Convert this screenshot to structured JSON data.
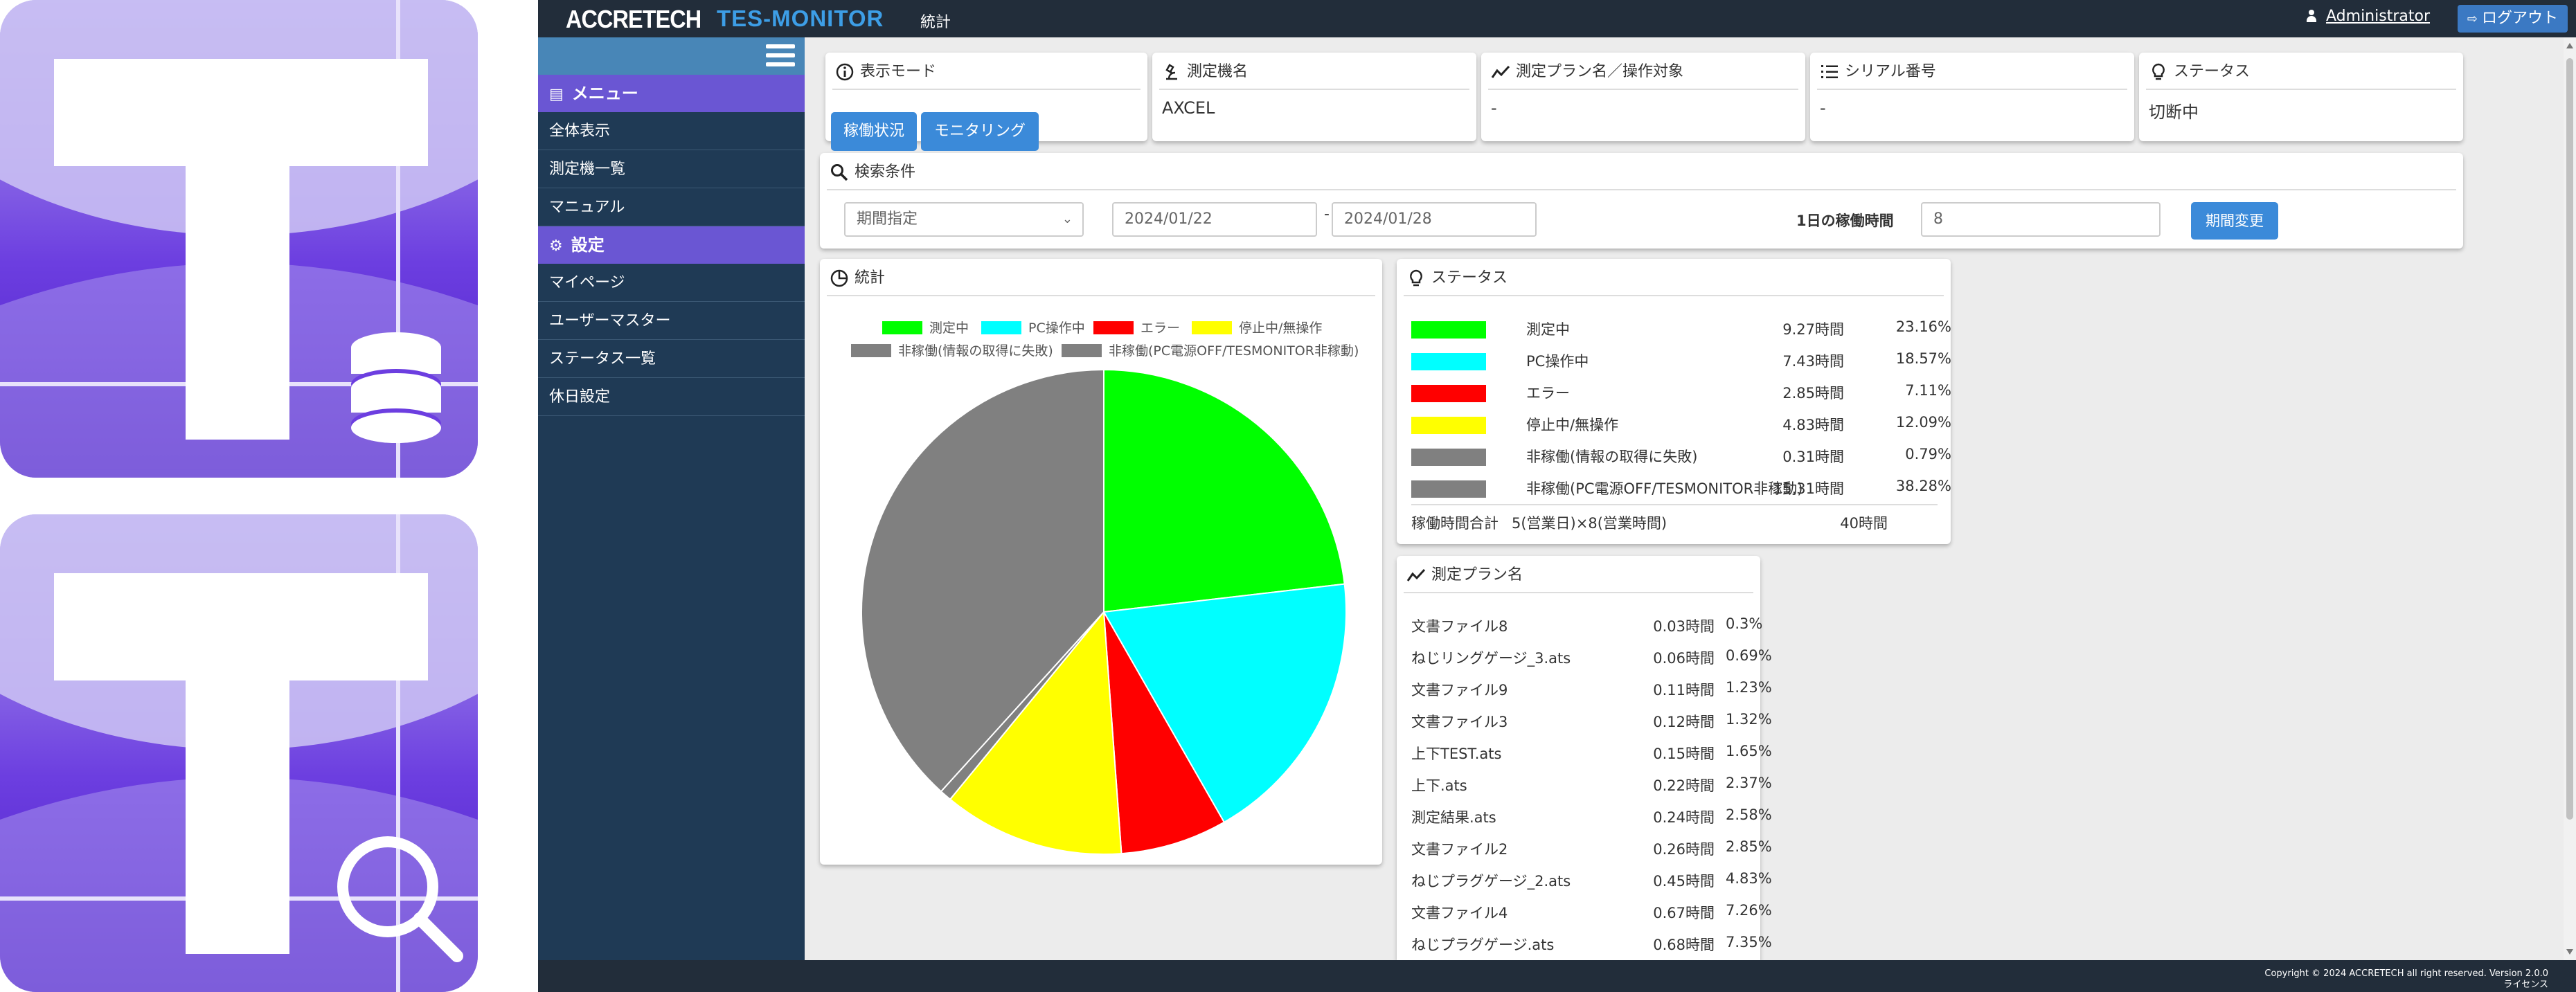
{
  "header": {
    "brand": "ACCRETECH",
    "app_name": "TES-MONITOR",
    "section": "統計",
    "user": "Administrator",
    "logout_label": "ログアウト"
  },
  "sidebar": {
    "menu_header": "メニュー",
    "menu_items": [
      "全体表示",
      "測定機一覧",
      "マニュアル"
    ],
    "settings_header": "設定",
    "settings_items": [
      "マイページ",
      "ユーザーマスター",
      "ステータス一覧",
      "休日設定"
    ]
  },
  "cards": {
    "display_mode": {
      "title": "表示モード",
      "btn_operation": "稼働状況",
      "btn_monitoring": "モニタリング"
    },
    "machine": {
      "title": "測定機名",
      "value": "AXCEL"
    },
    "plan": {
      "title": "測定プラン名／操作対象",
      "value": "-"
    },
    "serial": {
      "title": "シリアル番号",
      "value": "-"
    },
    "status": {
      "title": "ステータス",
      "value": "切断中"
    }
  },
  "search": {
    "title": "検索条件",
    "period_select": "期間指定",
    "date_from": "2024/01/22",
    "separator": "-",
    "date_to": "2024/01/28",
    "hours_label": "1日の稼働時間",
    "hours_value": "8",
    "apply_label": "期間変更"
  },
  "stats": {
    "title": "統計"
  },
  "chart_data": {
    "type": "pie",
    "labels": [
      "測定中",
      "PC操作中",
      "エラー",
      "停止中/無操作",
      "非稼働(情報の取得に失敗)",
      "非稼働(PC電源OFF/TESMONITOR非稼動)"
    ],
    "values": [
      23.16,
      18.57,
      7.11,
      12.09,
      0.79,
      38.28
    ],
    "colors": [
      "#00ff00",
      "#00ffff",
      "#ff0000",
      "#ffff00",
      "#808080",
      "#808080"
    ],
    "legend": "top"
  },
  "status_table": {
    "title": "ステータス",
    "rows": [
      {
        "label": "測定中",
        "hours": "9.27時間",
        "pct": "23.16%",
        "color": "#00ff00"
      },
      {
        "label": "PC操作中",
        "hours": "7.43時間",
        "pct": "18.57%",
        "color": "#00ffff"
      },
      {
        "label": "エラー",
        "hours": "2.85時間",
        "pct": "7.11%",
        "color": "#ff0000"
      },
      {
        "label": "停止中/無操作",
        "hours": "4.83時間",
        "pct": "12.09%",
        "color": "#ffff00"
      },
      {
        "label": "非稼働(情報の取得に失敗)",
        "hours": "0.31時間",
        "pct": "0.79%",
        "color": "#808080"
      },
      {
        "label": "非稼働(PC電源OFF/TESMONITOR非稼動)",
        "hours": "15.31時間",
        "pct": "38.28%",
        "color": "#808080"
      }
    ],
    "total_label": "稼働時間合計",
    "total_formula": "5(営業日)×8(営業時間)",
    "total_hours": "40時間"
  },
  "plan_table": {
    "title": "測定プラン名",
    "rows": [
      {
        "name": "文書ファイル8",
        "hours": "0.03時間",
        "pct": "0.3%"
      },
      {
        "name": "ねじリングゲージ_3.ats",
        "hours": "0.06時間",
        "pct": "0.69%"
      },
      {
        "name": "文書ファイル9",
        "hours": "0.11時間",
        "pct": "1.23%"
      },
      {
        "name": "文書ファイル3",
        "hours": "0.12時間",
        "pct": "1.32%"
      },
      {
        "name": "上下TEST.ats",
        "hours": "0.15時間",
        "pct": "1.65%"
      },
      {
        "name": "上下.ats",
        "hours": "0.22時間",
        "pct": "2.37%"
      },
      {
        "name": "測定結果.ats",
        "hours": "0.24時間",
        "pct": "2.58%"
      },
      {
        "name": "文書ファイル2",
        "hours": "0.26時間",
        "pct": "2.85%"
      },
      {
        "name": "ねじプラグゲージ_2.ats",
        "hours": "0.45時間",
        "pct": "4.83%"
      },
      {
        "name": "文書ファイル4",
        "hours": "0.67時間",
        "pct": "7.26%"
      },
      {
        "name": "ねじプラグゲージ.ats",
        "hours": "0.68時間",
        "pct": "7.35%"
      }
    ]
  },
  "footer": {
    "copyright": "Copyright © 2024 ACCRETECH all right reserved. Version 2.0.0",
    "license": "ライセンス"
  }
}
